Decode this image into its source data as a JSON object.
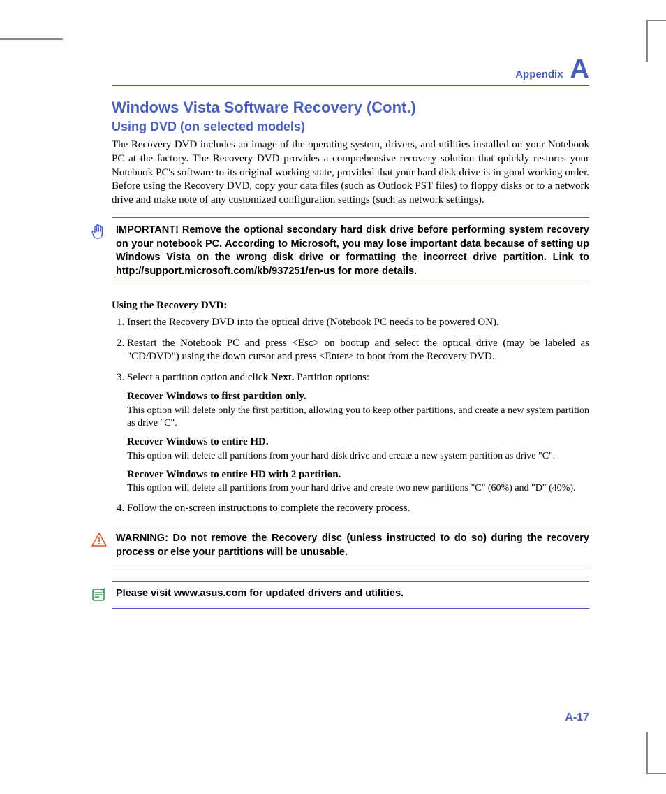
{
  "chapter": {
    "label": "Appendix",
    "letter": "A"
  },
  "title": "Windows Vista Software Recovery (Cont.)",
  "subtitle": "Using DVD (on selected models)",
  "intro": "The Recovery DVD includes an image of the operating system, drivers, and utilities installed on your Notebook PC at the factory. The Recovery DVD provides a comprehensive recovery solution that quickly restores your Notebook PC's software to its original working state, provided that your hard disk drive is in good working order. Before using the Recovery DVD, copy your data files (such as Outlook PST files) to floppy disks or to a network drive and make note of any customized configuration settings (such as network settings).",
  "important": {
    "prefix": "IMPORTANT! Remove the optional secondary hard disk drive before performing system recovery on your notebook PC. According to Microsoft, you may lose important data because of setting up Windows Vista on the wrong disk drive or formatting the incorrect drive partition. Link to ",
    "link_text": "http://support.microsoft.com/kb/937251/en-us",
    "suffix": " for more details."
  },
  "steps_heading": "Using the Recovery DVD:",
  "steps": [
    {
      "text": "Insert the Recovery DVD into the optical drive (Notebook PC needs to be powered ON)."
    },
    {
      "text": "Restart the Notebook PC and press <Esc> on bootup and select the optical drive (may be labeled as \"CD/DVD\") using the down cursor and press <Enter> to boot from the Recovery DVD."
    },
    {
      "text_prefix": "Select a partition option and click ",
      "text_bold": "Next.",
      "text_suffix": " Partition options:",
      "options": [
        {
          "title": "Recover Windows to first partition only.",
          "desc": "This option will delete only the first partition, allowing you to keep other partitions, and create a new system partition as drive \"C\"."
        },
        {
          "title": "Recover Windows to entire HD.",
          "desc": "This option will delete all partitions from your hard disk drive and create a new system partition as drive \"C\"."
        },
        {
          "title": "Recover Windows to entire HD with 2 partition.",
          "desc": "This option will delete all partitions from your hard drive and create two new partitions \"C\" (60%) and \"D\" (40%)."
        }
      ]
    },
    {
      "text": "Follow the on-screen instructions to complete the recovery process."
    }
  ],
  "warning": "WARNING: Do not remove the Recovery disc (unless instructed to do so) during the recovery process or else your partitions will be unusable.",
  "note": "Please visit www.asus.com for updated drivers and utilities.",
  "page_number": "A-17"
}
